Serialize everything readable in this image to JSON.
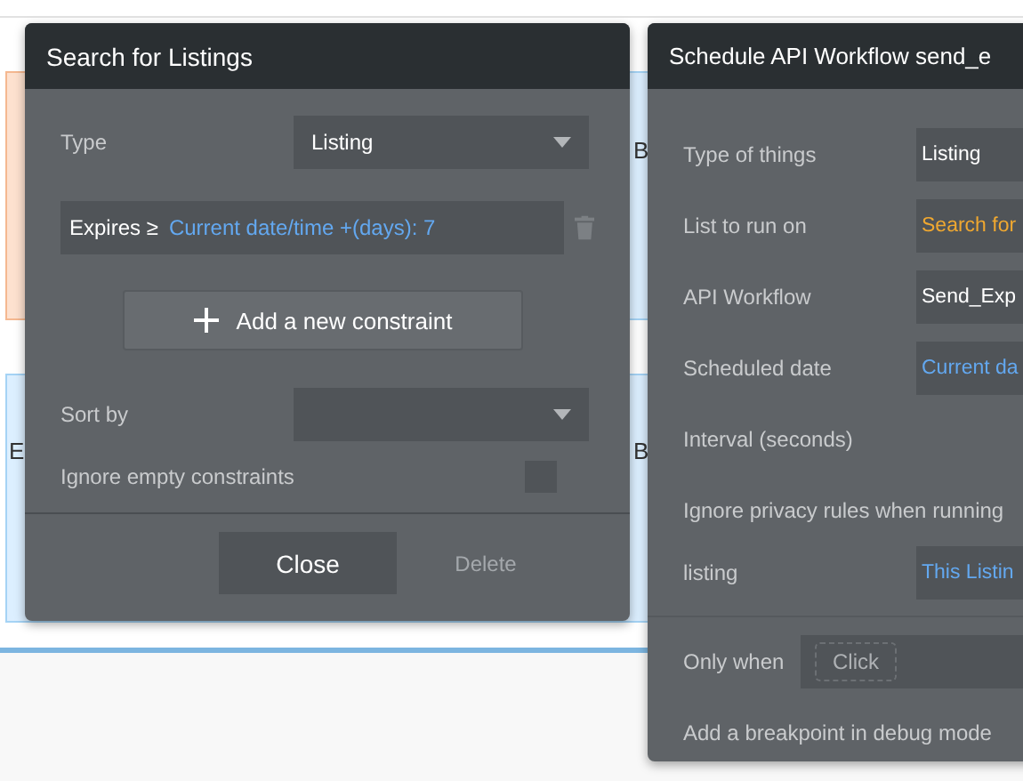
{
  "canvas": {
    "fragments": [
      {
        "text": "B",
        "kind": "right"
      },
      {
        "text": "E",
        "kind": "left"
      },
      {
        "text": "B",
        "kind": "lower-right"
      }
    ]
  },
  "search_panel": {
    "title": "Search for Listings",
    "type": {
      "label": "Type",
      "value": "Listing"
    },
    "constraints": [
      {
        "field": "Expires ≥",
        "value": "Current date/time +(days): 7"
      }
    ],
    "add_button": "Add a new constraint",
    "sort_by": {
      "label": "Sort by"
    },
    "ignore_empty": {
      "label": "Ignore empty constraints",
      "checked": false
    },
    "buttons": [
      {
        "label": "Close",
        "disabled": false
      },
      {
        "label": "Delete",
        "disabled": true
      }
    ]
  },
  "workflow_panel": {
    "title": "Schedule API Workflow send_e",
    "rows": [
      {
        "label": "Type of things",
        "value": "Listing",
        "kind": "plain"
      },
      {
        "label": "List to run on",
        "value": "Search for",
        "kind": "search"
      },
      {
        "label": "API Workflow",
        "value": "Send_Exp",
        "kind": "plain"
      },
      {
        "label": "Scheduled date",
        "value": "Current da",
        "kind": "expression"
      },
      {
        "label": "Interval (seconds)"
      },
      {
        "label": "Ignore privacy rules when running"
      },
      {
        "label": "listing",
        "value": "This Listin",
        "kind": "expression"
      }
    ],
    "only_when": {
      "label": "Only when",
      "placeholder": "Click"
    },
    "breakpoint": {
      "label": "Add a breakpoint in debug mode"
    }
  }
}
